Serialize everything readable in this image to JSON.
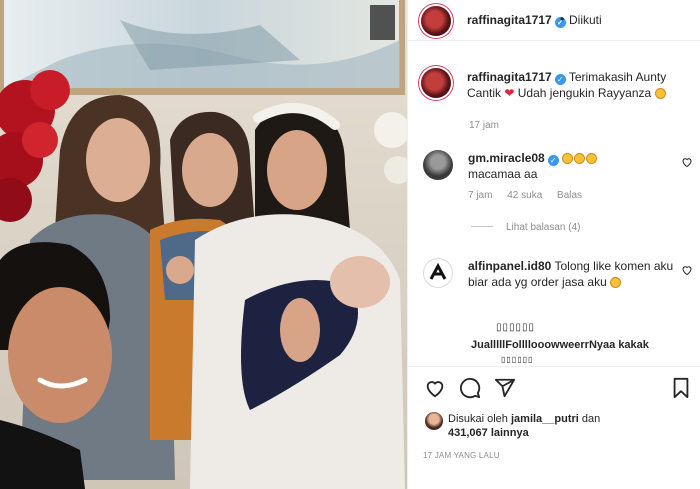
{
  "post": {
    "username": "raffinagita1717",
    "separator": "•",
    "follow_status": "Diikuti"
  },
  "caption": {
    "username": "raffinagita1717",
    "text_part1": "Terimakasih Aunty Cantik",
    "text_part2": "Udah jengukin Rayyanza",
    "time": "17 jam"
  },
  "comments": [
    {
      "username": "gm.miracle08",
      "text": "macamaa aa",
      "time": "7 jam",
      "likes": "42 suka",
      "reply_label": "Balas"
    },
    {
      "username": "alfinpanel.id80",
      "text": "Tolong like komen aku biar ada yg order jasa aku"
    }
  ],
  "replies_label": "Lihat balasan (4)",
  "spam_line1": "▯▯▯▯▯▯",
  "spam_line2": "JualllllFollllooowweerrNyaa kakak",
  "spam_line3": "▯▯▯▯▯▯",
  "likes": {
    "prefix": "Disukai oleh",
    "user": "jamila__putri",
    "conjunction": "dan",
    "count": "431,067",
    "suffix": "lainnya"
  },
  "time_ago": "17 JAM YANG LALU",
  "colors": {
    "verified": "#3897f0",
    "text": "#262626",
    "muted": "#8e8e8e",
    "heart": "#e0243a"
  },
  "icons": [
    "heart-icon",
    "comment-icon",
    "share-icon",
    "bookmark-icon",
    "verified-icon",
    "like-comment-icon"
  ]
}
